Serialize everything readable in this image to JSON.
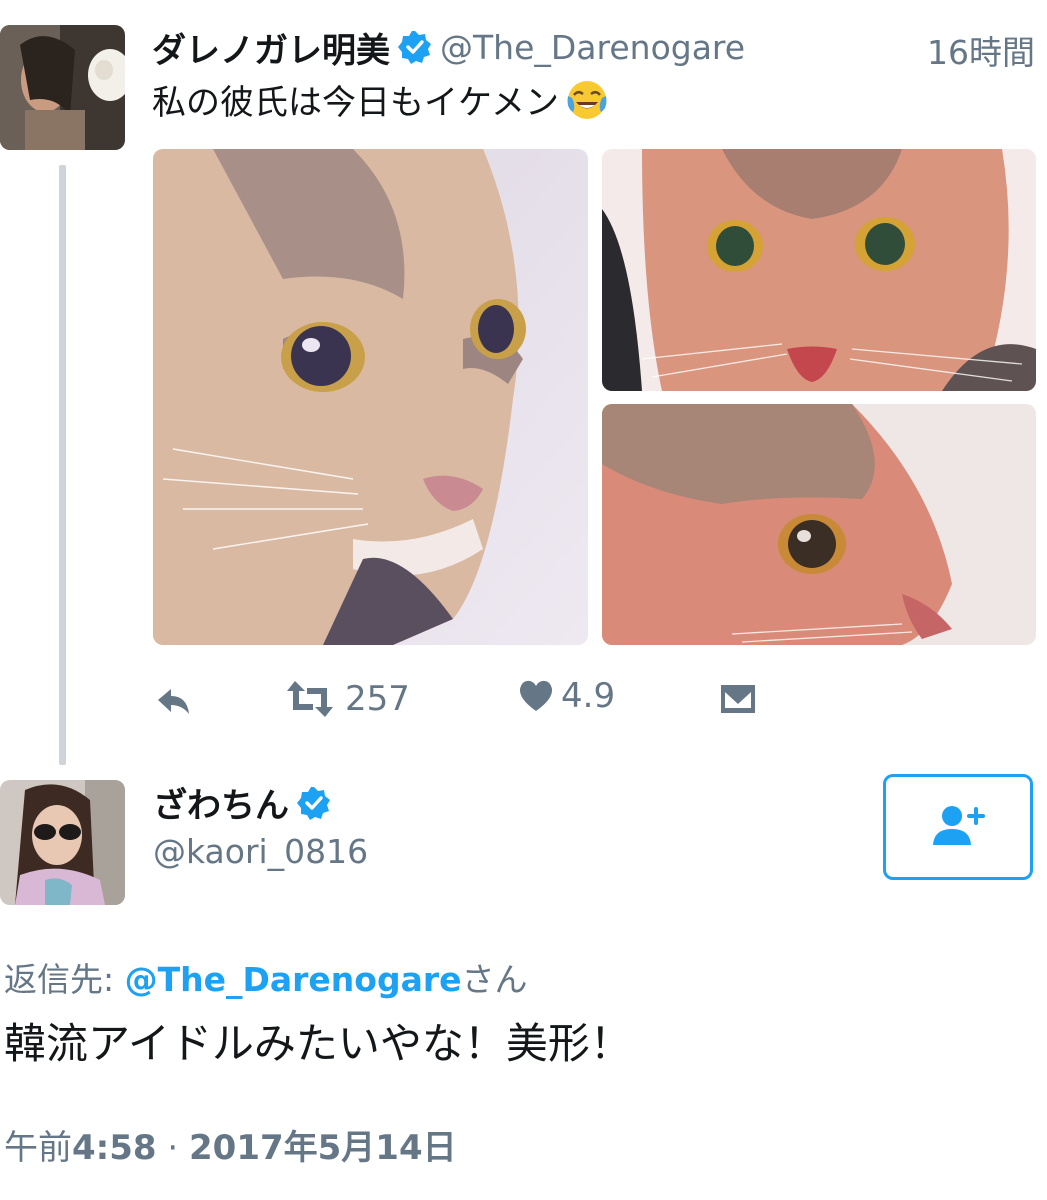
{
  "tweet1": {
    "author_name": "ダレノガレ明美",
    "author_handle": "@The_Darenogare",
    "time": "16時間",
    "text": "私の彼氏は今日もイケメン",
    "emoji": "face-with-tears-of-joy-icon",
    "media": [
      "cat-photo-left",
      "cat-photo-top-right",
      "cat-photo-bottom-right"
    ],
    "actions": {
      "reply_icon": "reply-icon",
      "retweet_icon": "retweet-icon",
      "retweet_count": "257",
      "like_icon": "heart-icon",
      "like_count": "4.9",
      "dm_icon": "direct-message-icon"
    }
  },
  "tweet2": {
    "author_name": "ざわちん",
    "author_handle": "@kaori_0816",
    "follow_icon": "add-user-icon",
    "reply_prefix": "返信先: ",
    "reply_mention": "@The_Darenogare",
    "reply_suffix": "さん",
    "text": "韓流アイドルみたいやな！美形！",
    "time_prefix": "午前",
    "time_value": "4:58",
    "time_separator": " · ",
    "date_value": "2017年5月14日"
  },
  "colors": {
    "accent": "#1da1f2",
    "secondary_text": "#657786",
    "thread_line": "#cfd4d9"
  }
}
